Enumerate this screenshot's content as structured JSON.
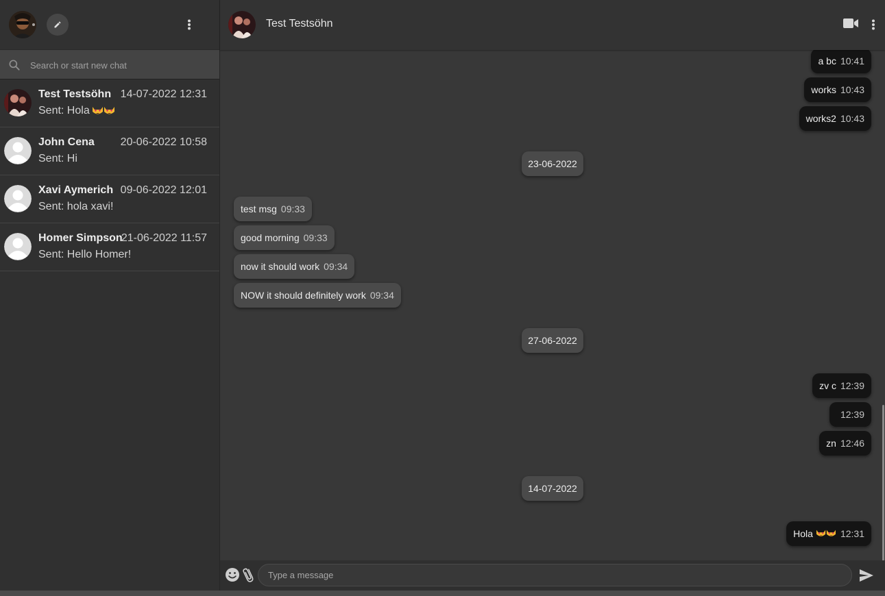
{
  "sidebar": {
    "search": {
      "placeholder": "Search or start new chat"
    },
    "chats": [
      {
        "name": "Test Testsöhn",
        "date": "14-07-2022 12:31",
        "preview": "Sent: Hola",
        "preview_emoji": "heart-eyes-cat-emoji x2"
      },
      {
        "name": "John Cena",
        "date": "20-06-2022 10:58",
        "preview": "Sent: Hi"
      },
      {
        "name": "Xavi Aymerich",
        "date": "09-06-2022 12:01",
        "preview": "Sent: hola xavi!"
      },
      {
        "name": "Homer Simpson",
        "date": "21-06-2022 11:57",
        "preview": "Sent: Hello Homer!"
      }
    ]
  },
  "chat": {
    "contact_name": "Test Testsöhn",
    "dates": [
      "23-06-2022",
      "27-06-2022",
      "14-07-2022"
    ],
    "messages": [
      {
        "text": "a bc",
        "time": "10:41",
        "dir": "out"
      },
      {
        "text": "works",
        "time": "10:43",
        "dir": "out"
      },
      {
        "text": "works2",
        "time": "10:43",
        "dir": "out"
      },
      {
        "text": "test msg",
        "time": "09:33",
        "dir": "in"
      },
      {
        "text": "good morning",
        "time": "09:33",
        "dir": "in"
      },
      {
        "text": "now it should work",
        "time": "09:34",
        "dir": "in"
      },
      {
        "text": "NOW it should definitely work",
        "time": "09:34",
        "dir": "in"
      },
      {
        "text": "zv c",
        "time": "12:39",
        "dir": "out"
      },
      {
        "text": "",
        "time": "12:39",
        "dir": "out"
      },
      {
        "text": "zn",
        "time": "12:46",
        "dir": "out"
      },
      {
        "text": "Hola",
        "time": "12:31",
        "dir": "out"
      }
    ],
    "composer": {
      "placeholder": "Type a message"
    }
  },
  "colors": {
    "outgoing_bubble": "#141414",
    "incoming_bubble": "#4a4a4a",
    "background": "#383838"
  }
}
